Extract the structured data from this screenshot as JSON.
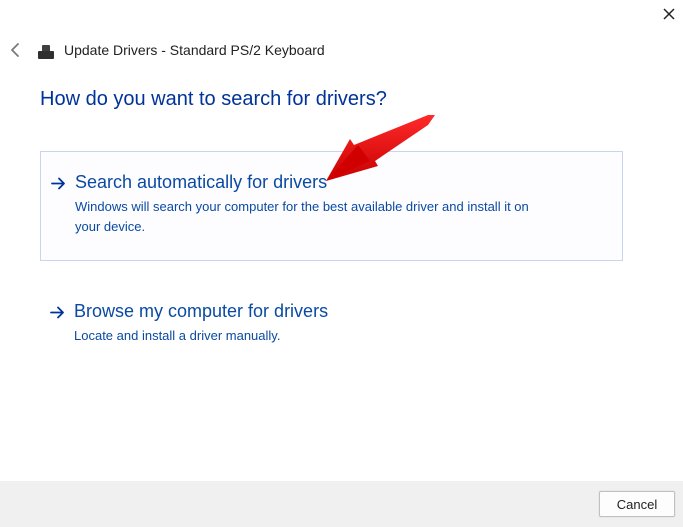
{
  "window": {
    "title": "Update Drivers - Standard PS/2 Keyboard"
  },
  "question": "How do you want to search for drivers?",
  "options": {
    "auto": {
      "title": "Search automatically for drivers",
      "desc": "Windows will search your computer for the best available driver and install it on your device."
    },
    "browse": {
      "title": "Browse my computer for drivers",
      "desc": "Locate and install a driver manually."
    }
  },
  "footer": {
    "cancel_label": "Cancel"
  }
}
